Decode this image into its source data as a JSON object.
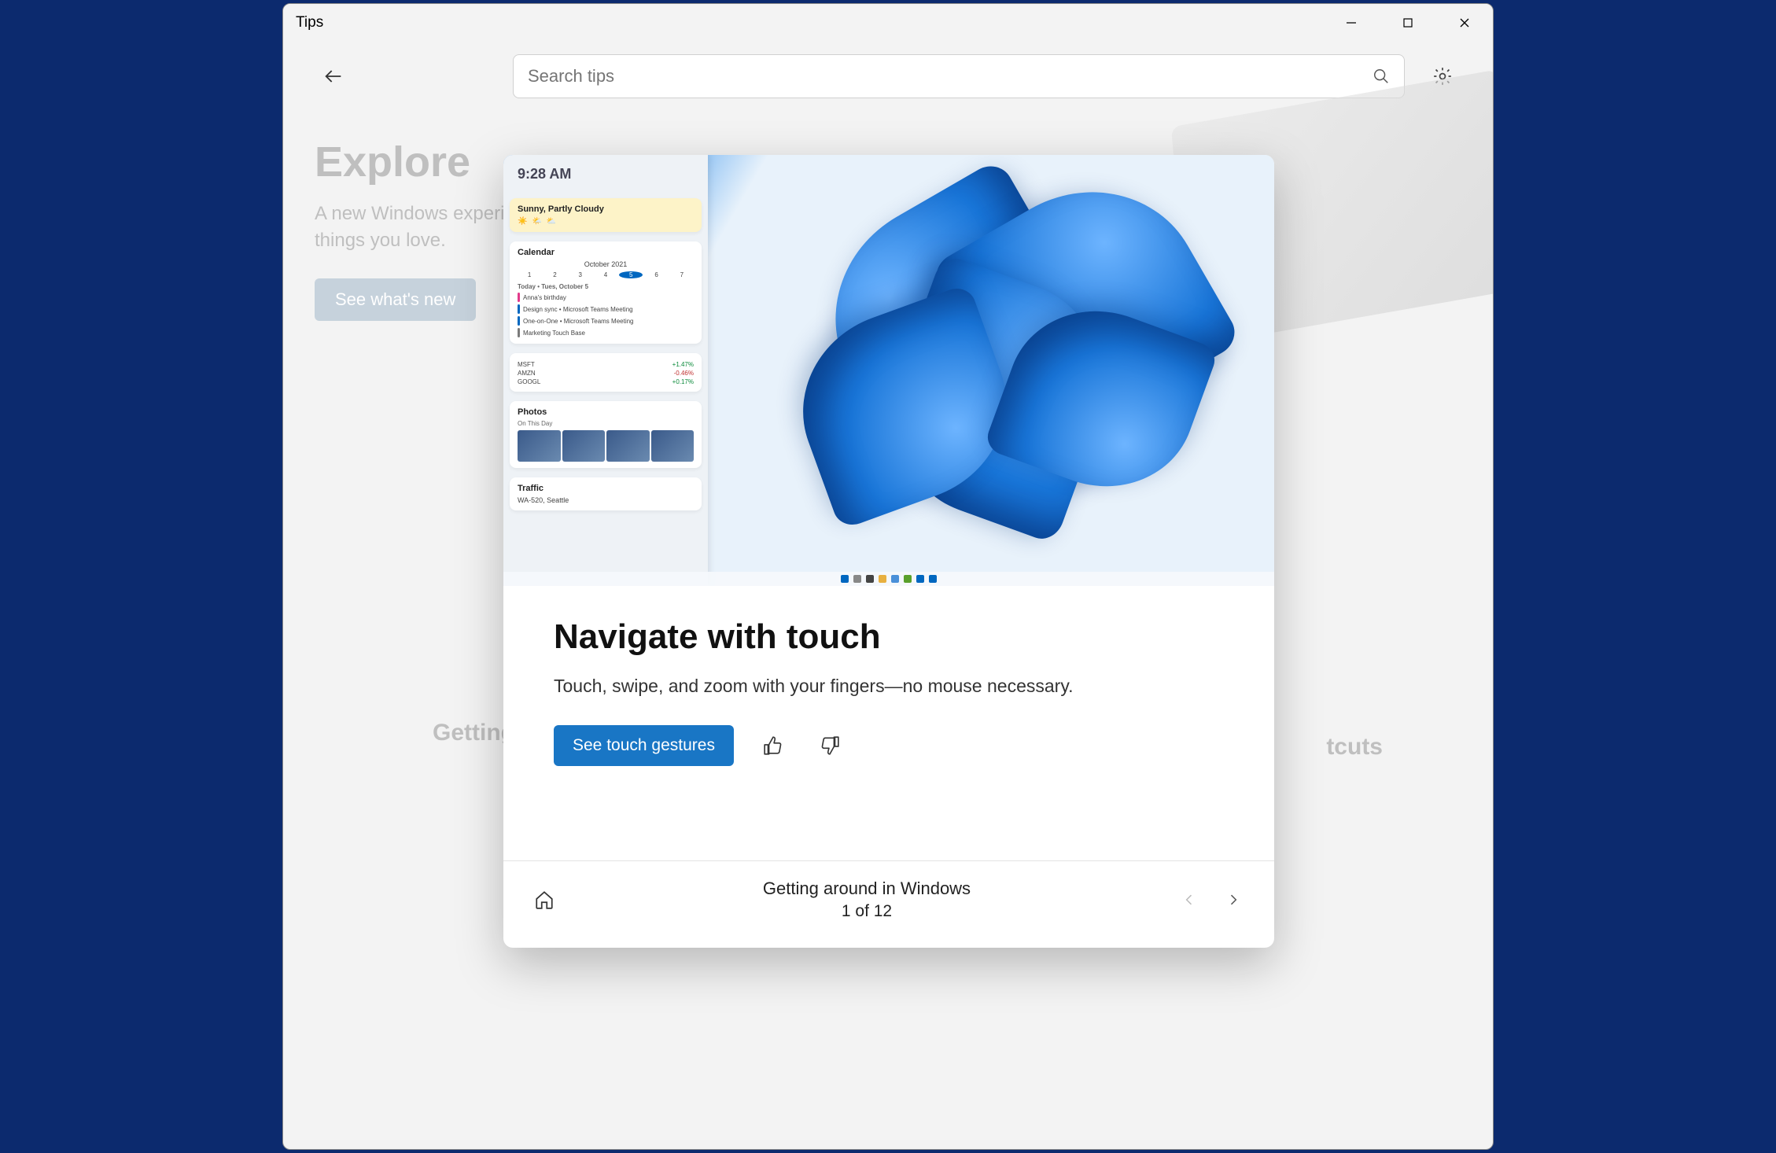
{
  "window": {
    "title": "Tips"
  },
  "toolbar": {
    "search_placeholder": "Search tips"
  },
  "background": {
    "hero_title": "Explore",
    "hero_sub": "A new Windows experience for the things you love.",
    "hero_button": "See what's new",
    "left_word": "Getting",
    "right_word": "tcuts"
  },
  "hero": {
    "time": "9:28 AM",
    "weather_title": "Sunny, Partly Cloudy",
    "calendar_title": "Calendar",
    "calendar_month": "October 2021",
    "agenda_title": "Today • Tues, October 5",
    "agenda": [
      {
        "color": "#e23a8a",
        "text": "Anna's birthday"
      },
      {
        "color": "#0067c0",
        "text": "Design sync • Microsoft Teams Meeting"
      },
      {
        "color": "#0067c0",
        "text": "One-on-One • Microsoft Teams Meeting"
      },
      {
        "color": "#7a7a7a",
        "text": "Marketing Touch Base"
      }
    ],
    "stocks": [
      {
        "sym": "MSFT",
        "pct": "+1.47%",
        "cls": "green"
      },
      {
        "sym": "AMZN",
        "pct": "-0.46%",
        "cls": "red"
      },
      {
        "sym": "GOOGL",
        "pct": "+0.17%",
        "cls": "green"
      }
    ],
    "photos_title": "Photos",
    "photos_sub": "On This Day",
    "traffic_title": "Traffic",
    "traffic_text": "WA-520, Seattle"
  },
  "tip": {
    "title": "Navigate with touch",
    "body": "Touch, swipe, and zoom with your fingers—no mouse necessary.",
    "cta": "See touch gestures"
  },
  "footer": {
    "collection": "Getting around in Windows",
    "page_label": "1 of 12"
  }
}
